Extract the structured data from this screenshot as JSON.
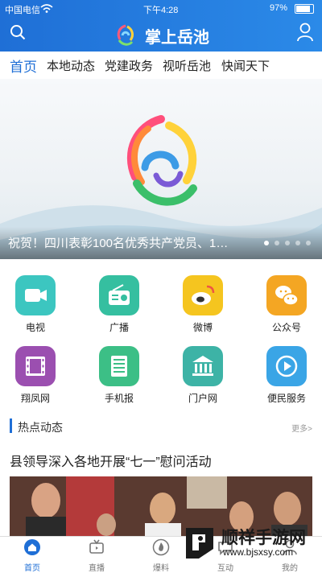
{
  "status_bar": {
    "carrier": "中国电信",
    "time": "下午4:28",
    "battery": "97%"
  },
  "header": {
    "title": "掌上岳池"
  },
  "tabs": [
    {
      "label": "首页",
      "active": true
    },
    {
      "label": "本地动态",
      "active": false
    },
    {
      "label": "党建政务",
      "active": false
    },
    {
      "label": "视听岳池",
      "active": false
    },
    {
      "label": "快闻天下",
      "active": false
    }
  ],
  "banner": {
    "caption": "祝贺！四川表彰100名优秀共产党员、1…",
    "dot_count": 5,
    "active_dot": 1
  },
  "grid": [
    {
      "label": "电视",
      "icon": "video-camera-icon",
      "color": "#3cc6c0"
    },
    {
      "label": "广播",
      "icon": "radio-icon",
      "color": "#35bfa0"
    },
    {
      "label": "微博",
      "icon": "weibo-icon",
      "color": "#f5c51f"
    },
    {
      "label": "公众号",
      "icon": "wechat-icon",
      "color": "#f4a623"
    },
    {
      "label": "翔凤网",
      "icon": "film-icon",
      "color": "#9b4fb0"
    },
    {
      "label": "手机报",
      "icon": "newspaper-icon",
      "color": "#3cbf86"
    },
    {
      "label": "门户网",
      "icon": "bank-icon",
      "color": "#3db3a6"
    },
    {
      "label": "便民服务",
      "icon": "play-icon",
      "color": "#3aa5e6"
    }
  ],
  "section": {
    "title": "热点动态",
    "more": "更多>"
  },
  "news": {
    "headline": "县领导深入各地开展“七一”慰问活动"
  },
  "bottom_nav": [
    {
      "label": "首页",
      "icon": "home-icon",
      "active": true
    },
    {
      "label": "直播",
      "icon": "tv-icon",
      "active": false
    },
    {
      "label": "爆料",
      "icon": "fire-icon",
      "active": false
    },
    {
      "label": "互动",
      "icon": "chat-icon",
      "active": false
    },
    {
      "label": "我的",
      "icon": "user-icon",
      "active": false
    }
  ],
  "watermark": {
    "text": "顺祥手游网",
    "url": "www.bjsxsy.com"
  },
  "colors": {
    "brand_blue": "#1f6fd6"
  }
}
